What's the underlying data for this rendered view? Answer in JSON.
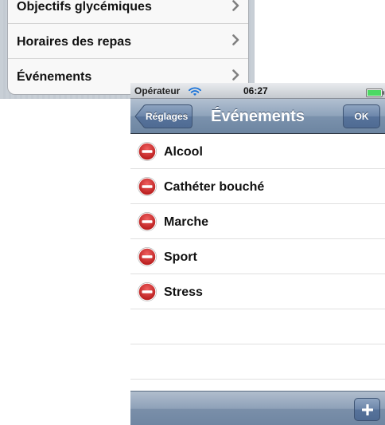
{
  "background_screen": {
    "items": [
      {
        "label": "Objectifs glycémiques"
      },
      {
        "label": "Horaires des repas"
      },
      {
        "label": "Événements"
      }
    ]
  },
  "status_bar": {
    "carrier": "Opérateur",
    "time": "06:27"
  },
  "nav_bar": {
    "back_label": "Réglages",
    "title": "Événements",
    "ok_label": "OK"
  },
  "events": [
    {
      "label": "Alcool",
      "icon": "delete-icon"
    },
    {
      "label": "Cathéter bouché",
      "icon": "delete-icon"
    },
    {
      "label": "Marche",
      "icon": "delete-icon"
    },
    {
      "label": "Sport",
      "icon": "delete-icon"
    },
    {
      "label": "Stress",
      "icon": "delete-icon"
    }
  ],
  "toolbar": {
    "add_icon": "plus-icon"
  },
  "colors": {
    "nav_bar": "#8ea3bb",
    "delete_red": "#d42b2b",
    "battery_green": "#4cd964"
  }
}
